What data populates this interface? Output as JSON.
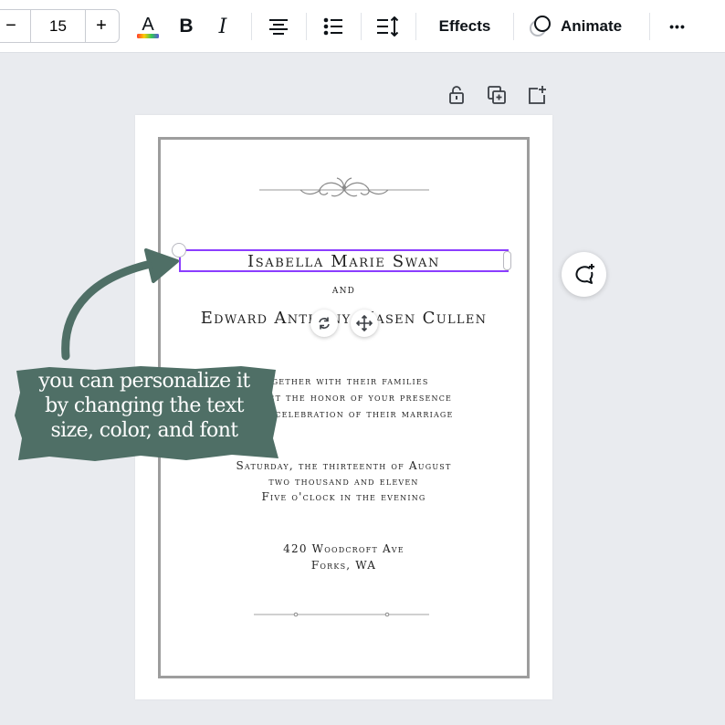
{
  "toolbar": {
    "font_size_minus": "−",
    "font_size_value": "15",
    "font_size_plus": "+",
    "effects_label": "Effects",
    "animate_label": "Animate",
    "more_label": "•••"
  },
  "invitation": {
    "bride": "Isabella Marie Swan",
    "and": "and",
    "groom": "Edward Anthony Masen Cullen",
    "line1": "together with their families",
    "line2": "request the honor of your presence",
    "line3": "at the celebration of their marriage",
    "date1": "Saturday, the thirteenth of August",
    "date2": "two thousand and eleven",
    "date3": "Five o'clock in the evening",
    "address1": "420 Woodcroft Ave",
    "address2": "Forks, WA"
  },
  "callout": {
    "line1": "you can personalize it",
    "line2": "by changing the text",
    "line3": "size, color, and font",
    "color": "#4f6f66"
  },
  "colors": {
    "selection": "#8b3dff",
    "frame": "#9d9d9d",
    "canvas_bg": "#e9ebef"
  }
}
